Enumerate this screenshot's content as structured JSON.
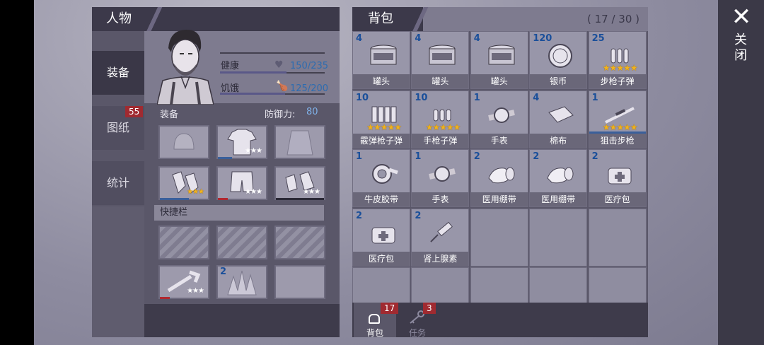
{
  "left_panel": {
    "title": "人物",
    "tabs": [
      {
        "label": "装备"
      },
      {
        "label": "图纸",
        "badge": "55"
      },
      {
        "label": "统计"
      }
    ],
    "stats": {
      "health_label": "健康",
      "health_value": "150/235",
      "hunger_label": "饥饿",
      "hunger_value": "125/200"
    },
    "equipment": {
      "label": "装备",
      "defense_label": "防御力:",
      "defense_value": "80"
    },
    "quickbar": {
      "label": "快捷栏",
      "bush_qty": "2"
    }
  },
  "right_panel": {
    "title": "背包",
    "count": "( 17 / 30 )",
    "items": [
      {
        "qty": "4",
        "name": "罐头",
        "icon": "can-icon"
      },
      {
        "qty": "4",
        "name": "罐头",
        "icon": "can-icon"
      },
      {
        "qty": "4",
        "name": "罐头",
        "icon": "can-icon"
      },
      {
        "qty": "120",
        "name": "银币",
        "icon": "coin-icon"
      },
      {
        "qty": "25",
        "name": "步枪子弹",
        "icon": "rifle-ammo-icon"
      },
      {
        "qty": "10",
        "name": "霰弹枪子弹",
        "icon": "shotgun-shell-icon"
      },
      {
        "qty": "10",
        "name": "手枪子弹",
        "icon": "pistol-ammo-icon"
      },
      {
        "qty": "1",
        "name": "手表",
        "icon": "watch-icon"
      },
      {
        "qty": "4",
        "name": "棉布",
        "icon": "cloth-icon"
      },
      {
        "qty": "1",
        "name": "狙击步枪",
        "icon": "sniper-rifle-icon"
      },
      {
        "qty": "1",
        "name": "牛皮胶带",
        "icon": "duct-tape-icon"
      },
      {
        "qty": "1",
        "name": "手表",
        "icon": "watch-icon"
      },
      {
        "qty": "2",
        "name": "医用绷带",
        "icon": "bandage-icon"
      },
      {
        "qty": "2",
        "name": "医用绷带",
        "icon": "bandage-icon"
      },
      {
        "qty": "2",
        "name": "医疗包",
        "icon": "medkit-icon"
      },
      {
        "qty": "2",
        "name": "医疗包",
        "icon": "medkit-icon"
      },
      {
        "qty": "2",
        "name": "肾上腺素",
        "icon": "syringe-icon"
      }
    ],
    "footer_tabs": [
      {
        "label": "背包",
        "badge": "17",
        "icon": "backpack-icon"
      },
      {
        "label": "任务",
        "badge": "3",
        "icon": "key-icon"
      }
    ]
  },
  "close": {
    "label": "关闭"
  },
  "colors": {
    "qty_blue": "#1a4f9a",
    "badge_red": "#a02a30",
    "star_gold": "#f2b31a"
  }
}
